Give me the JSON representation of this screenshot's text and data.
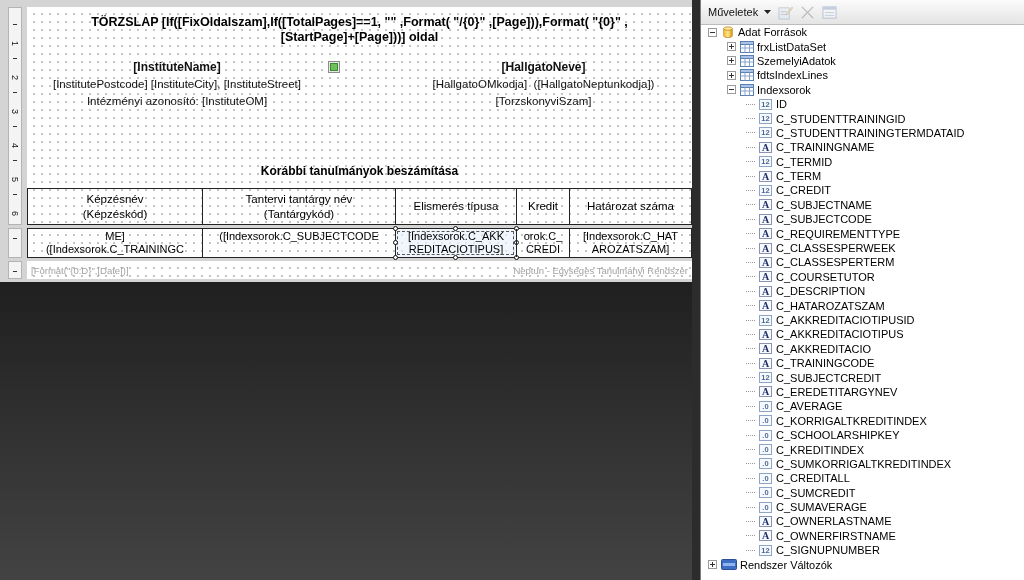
{
  "report_canvas": {
    "ruler": [
      "1",
      "2",
      "3",
      "4",
      "5",
      "6"
    ],
    "title": "TÖRZSLAP [If([FixOldalszam],If([TotalPages]==1, \"\" ,Format( \"/{0}\" ,[Page])),Format( \"{0}\" ,[StartPage]+[Page]))] oldal",
    "institute": {
      "name": "[InstituteName]",
      "address": "[InstitutePostcode] [InstituteCity], [InstituteStreet]",
      "id_line": "Intézményi azonosító: [InstituteOM]"
    },
    "student": {
      "name": "[HallgatoNeve]",
      "codes": "[HallgatoOMkodja]  ([HallgatoNeptunkodja])",
      "register_number": "[TorzskonyviSzam]"
    },
    "section_title": "Korábbi tanulmányok beszámítása",
    "table": {
      "columns": [
        "Képzésnév\n(Képzéskód)",
        "Tantervi tantárgy név\n(Tantárgykód)",
        "Elismerés típusa",
        "Kredit",
        "Határozat száma"
      ],
      "row": [
        {
          "text": "ME]\n([Indexsorok.C_TRAININGC",
          "selected": false
        },
        {
          "text": "([Indexsorok.C_SUBJECTCODE",
          "selected": false
        },
        {
          "text": "[Indexsorok.C_AKK\nREDITACIOTIPUS]",
          "selected": true
        },
        {
          "text": "orok.C_\nCREDI",
          "selected": false
        },
        {
          "text": "[Indexsorok.C_HAT\nAROZATSZAM]",
          "selected": false
        }
      ]
    },
    "footer": {
      "left": "[Format(\"{0:D}\",[Date])]",
      "right": "Neptun - Egységes Tanulmányi Rendszer"
    }
  },
  "data_panel": {
    "toolbar": {
      "menu": "Műveletek",
      "tools": [
        {
          "kind": "edit",
          "disabled": true
        },
        {
          "kind": "delete",
          "disabled": true
        },
        {
          "kind": "window",
          "disabled": true
        }
      ]
    },
    "tree": [
      {
        "label": "Adat Források",
        "kind": "database",
        "expanded": true,
        "children": [
          {
            "label": "frxListDataSet",
            "kind": "table",
            "expanded": false
          },
          {
            "label": "SzemelyiAdatok",
            "kind": "table",
            "expanded": false
          },
          {
            "label": "fdtsIndexLines",
            "kind": "table",
            "expanded": false
          },
          {
            "label": "Indexsorok",
            "kind": "table",
            "expanded": true,
            "children": [
              {
                "label": "ID",
                "kind": "int",
                "type_label": "12"
              },
              {
                "label": "C_STUDENTTRAININGID",
                "kind": "int",
                "type_label": "12"
              },
              {
                "label": "C_STUDENTTRAININGTERMDATAID",
                "kind": "int",
                "type_label": "12"
              },
              {
                "label": "C_TRAININGNAME",
                "kind": "string",
                "type_label": "A"
              },
              {
                "label": "C_TERMID",
                "kind": "int",
                "type_label": "12"
              },
              {
                "label": "C_TERM",
                "kind": "string",
                "type_label": "A"
              },
              {
                "label": "C_CREDIT",
                "kind": "int",
                "type_label": "12"
              },
              {
                "label": "C_SUBJECTNAME",
                "kind": "string",
                "type_label": "A"
              },
              {
                "label": "C_SUBJECTCODE",
                "kind": "string",
                "type_label": "A"
              },
              {
                "label": "C_REQUIREMENTTYPE",
                "kind": "string",
                "type_label": "A"
              },
              {
                "label": "C_CLASSESPERWEEK",
                "kind": "string",
                "type_label": "A"
              },
              {
                "label": "C_CLASSESPERTERM",
                "kind": "string",
                "type_label": "A"
              },
              {
                "label": "C_COURSETUTOR",
                "kind": "string",
                "type_label": "A"
              },
              {
                "label": "C_DESCRIPTION",
                "kind": "string",
                "type_label": "A"
              },
              {
                "label": "C_HATAROZATSZAM",
                "kind": "string",
                "type_label": "A"
              },
              {
                "label": "C_AKKREDITACIOTIPUSID",
                "kind": "int",
                "type_label": "12"
              },
              {
                "label": "C_AKKREDITACIOTIPUS",
                "kind": "string",
                "type_label": "A"
              },
              {
                "label": "C_AKKREDITACIO",
                "kind": "string",
                "type_label": "A"
              },
              {
                "label": "C_TRAININGCODE",
                "kind": "string",
                "type_label": "A"
              },
              {
                "label": "C_SUBJECTCREDIT",
                "kind": "int",
                "type_label": "12"
              },
              {
                "label": "C_EREDETITARGYNEV",
                "kind": "string",
                "type_label": "A"
              },
              {
                "label": "C_AVERAGE",
                "kind": "decimal",
                "type_label": ".0"
              },
              {
                "label": "C_KORRIGALTKREDITINDEX",
                "kind": "decimal",
                "type_label": ".0"
              },
              {
                "label": "C_SCHOOLARSHIPKEY",
                "kind": "decimal",
                "type_label": ".0"
              },
              {
                "label": "C_KREDITINDEX",
                "kind": "decimal",
                "type_label": ".0"
              },
              {
                "label": "C_SUMKORRIGALTKREDITINDEX",
                "kind": "decimal",
                "type_label": ".0"
              },
              {
                "label": "C_CREDITALL",
                "kind": "decimal",
                "type_label": ".0"
              },
              {
                "label": "C_SUMCREDIT",
                "kind": "decimal",
                "type_label": ".0"
              },
              {
                "label": "C_SUMAVERAGE",
                "kind": "decimal",
                "type_label": ".0"
              },
              {
                "label": "C_OWNERLASTNAME",
                "kind": "string",
                "type_label": "A"
              },
              {
                "label": "C_OWNERFIRSTNAME",
                "kind": "string",
                "type_label": "A"
              },
              {
                "label": "C_SIGNUPNUMBER",
                "kind": "int",
                "type_label": "12"
              }
            ]
          }
        ]
      },
      {
        "label": "Rendszer Változók",
        "kind": "variables",
        "expanded": false
      }
    ]
  }
}
